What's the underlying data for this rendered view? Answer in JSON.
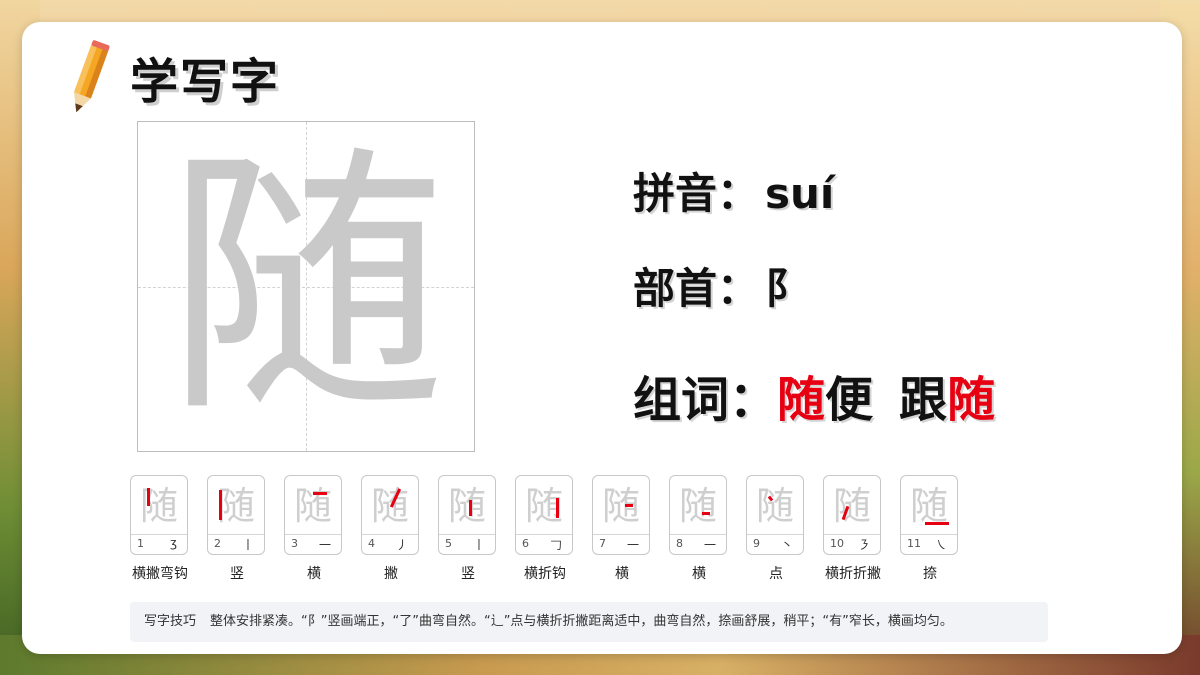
{
  "title": "学写字",
  "character": "随",
  "pinyin": {
    "label": "拼音：",
    "value": "suí"
  },
  "radical": {
    "label": "部首：",
    "value": "阝"
  },
  "words": {
    "label": "组词：",
    "word1_red": "随",
    "word1_rest": "便",
    "word2_rest": "跟",
    "word2_red": "随"
  },
  "strokes": [
    {
      "num": "1",
      "shape": "ʒ",
      "name": "横撇弯钩"
    },
    {
      "num": "2",
      "shape": "丨",
      "name": "竖"
    },
    {
      "num": "3",
      "shape": "一",
      "name": "横"
    },
    {
      "num": "4",
      "shape": "丿",
      "name": "撇"
    },
    {
      "num": "5",
      "shape": "丨",
      "name": "竖"
    },
    {
      "num": "6",
      "shape": "𠃌",
      "name": "横折钩"
    },
    {
      "num": "7",
      "shape": "一",
      "name": "横"
    },
    {
      "num": "8",
      "shape": "一",
      "name": "横"
    },
    {
      "num": "9",
      "shape": "丶",
      "name": "点"
    },
    {
      "num": "10",
      "shape": "㇋",
      "name": "横折折撇"
    },
    {
      "num": "11",
      "shape": "㇏",
      "name": "捺"
    }
  ],
  "tips": {
    "label": "写字技巧",
    "text": "整体安排紧凑。“阝”竖画端正，“了”曲弯自然。“辶”点与横折折撇距离适中，曲弯自然，捺画舒展，稍平；“有”窄长，横画均匀。"
  },
  "colors": {
    "accent_red": "#e60012",
    "ghost_gray": "#c9c9c9"
  }
}
